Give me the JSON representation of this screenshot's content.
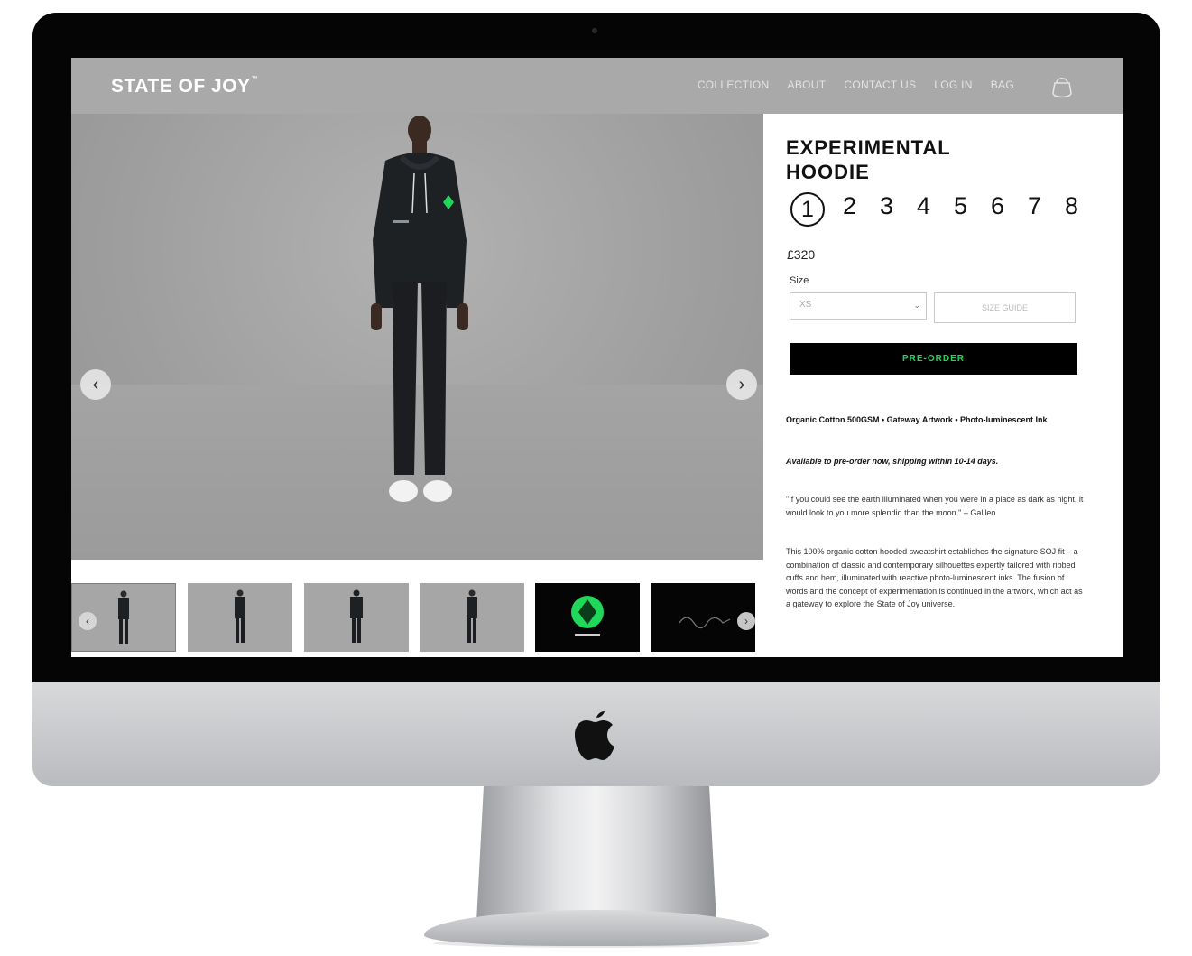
{
  "site": {
    "brand": "STATE OF JOY",
    "brand_mark": "™",
    "nav": [
      "COLLECTION",
      "ABOUT",
      "CONTACT US",
      "LOG IN",
      "BAG"
    ]
  },
  "gallery": {
    "thumbnail_count": 6,
    "thumbnail_style": [
      "photo",
      "photo",
      "photo",
      "photo",
      "green-artwork",
      "dark-artwork"
    ]
  },
  "product": {
    "title": "EXPERIMENTAL HOODIE",
    "editions": [
      "1",
      "2",
      "3",
      "4",
      "5",
      "6",
      "7",
      "8"
    ],
    "selected_edition": "1",
    "price": "£320",
    "size_label": "Size",
    "size_value": "XS",
    "size_guide_label": "SIZE GUIDE",
    "preorder_label": "PRE-ORDER",
    "material_line": "Organic Cotton 500GSM • Gateway Artwork • Photo-luminescent Ink",
    "availability": "Available to pre-order now, shipping within 10-14 days.",
    "quote": "\"If you could see the earth illuminated when you were in a place as dark as night, it would look to you more splendid than the moon.\" – Galileo",
    "description": "This 100% organic cotton hooded sweatshirt establishes the signature SOJ fit – a combination of classic and contemporary silhouettes expertly tailored with ribbed cuffs and hem, illuminated with reactive photo-luminescent inks. The fusion of words and the concept of experimentation is continued in the artwork, which act as a gateway to explore the State of Joy universe."
  },
  "colors": {
    "header_bg": "#a9a9a9",
    "preorder_bg": "#000000",
    "preorder_text": "#1fd75a",
    "accent_green": "#1fd75a"
  }
}
